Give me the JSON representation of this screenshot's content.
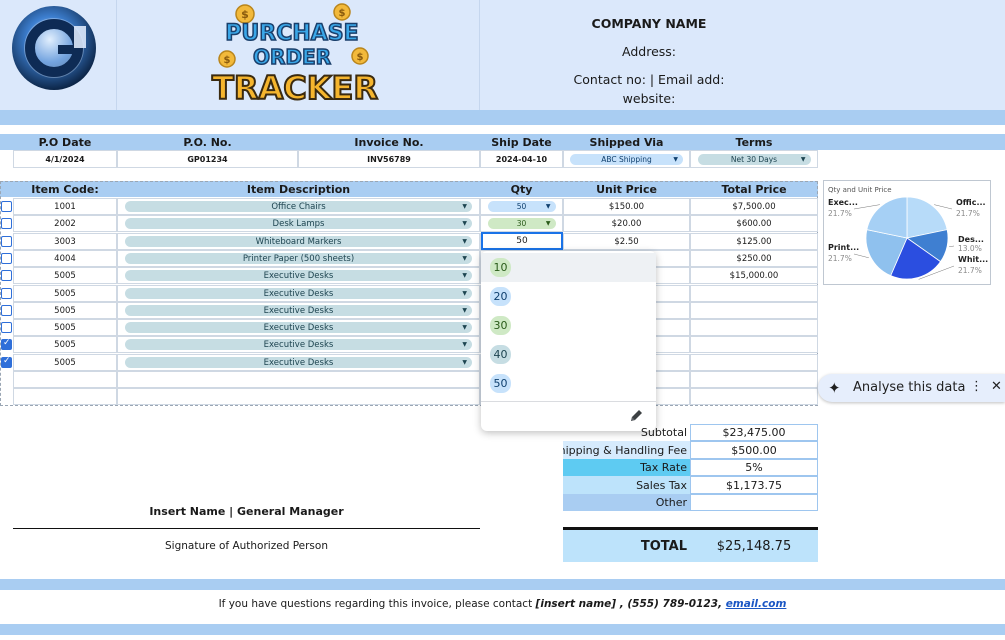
{
  "header": {
    "logo_letter": "G",
    "title_line1": "PURCHASE",
    "title_line2": "ORDER",
    "title_line3": "TRACKER",
    "company_name": "COMPANY NAME",
    "address": "Address:",
    "contact": "Contact no: | Email add:",
    "website": "website:"
  },
  "po": {
    "headers": [
      "P.O Date",
      "P.O. No.",
      "Invoice No.",
      "Ship Date",
      "Shipped Via",
      "Terms"
    ],
    "po_date": "4/1/2024",
    "po_no": "GP01234",
    "invoice_no": "INV56789",
    "ship_date": "2024-04-10",
    "shipped_via": "ABC Shipping",
    "terms": "Net 30 Days"
  },
  "items": {
    "headers": [
      "Item Code:",
      "Item Description",
      "Qty",
      "Unit Price",
      "Total Price"
    ],
    "rows": [
      {
        "code": "1001",
        "desc": "Office Chairs",
        "qty": "50",
        "unit": "$150.00",
        "total": "$7,500.00",
        "checked": false
      },
      {
        "code": "2002",
        "desc": "Desk Lamps",
        "qty": "30",
        "unit": "$20.00",
        "total": "$600.00",
        "checked": false
      },
      {
        "code": "3003",
        "desc": "Whiteboard Markers",
        "qty": "50",
        "unit": "$2.50",
        "total": "$125.00",
        "checked": false
      },
      {
        "code": "4004",
        "desc": "Printer Paper (500 sheets)",
        "qty": "",
        "unit": "",
        "total": "$250.00",
        "checked": false
      },
      {
        "code": "5005",
        "desc": "Executive Desks",
        "qty": "",
        "unit": "",
        "total": "$15,000.00",
        "checked": false
      },
      {
        "code": "5005",
        "desc": "Executive Desks",
        "qty": "",
        "unit": "",
        "total": "",
        "checked": false
      },
      {
        "code": "5005",
        "desc": "Executive Desks",
        "qty": "",
        "unit": "",
        "total": "",
        "checked": false
      },
      {
        "code": "5005",
        "desc": "Executive Desks",
        "qty": "",
        "unit": "",
        "total": "",
        "checked": false
      },
      {
        "code": "5005",
        "desc": "Executive Desks",
        "qty": "",
        "unit": "",
        "total": "",
        "checked": true
      },
      {
        "code": "5005",
        "desc": "Executive Desks",
        "qty": "",
        "unit": "",
        "total": "",
        "checked": true
      }
    ]
  },
  "qty_dropdown": {
    "options": [
      "10",
      "20",
      "30",
      "40",
      "50"
    ],
    "highlighted": "10",
    "edit_icon": "pencil-icon"
  },
  "chart_data": {
    "type": "pie",
    "title": "Qty and Unit Price",
    "categories": [
      "Office Chairs",
      "Desk Lamps",
      "Whiteboard Markers",
      "Printer Paper",
      "Executive Desks"
    ],
    "display_labels": [
      "Offic...",
      "Des...",
      "Whit...",
      "Print...",
      "Exec..."
    ],
    "values": [
      21.7,
      13.0,
      21.7,
      21.7,
      21.7
    ],
    "value_labels": [
      "21.7%",
      "13.0%",
      "21.7%",
      "21.7%",
      "21.7%"
    ],
    "colors": [
      "#b7dbf9",
      "#3f7fd1",
      "#2b4ee0",
      "#8fc1ee",
      "#a6d0f5"
    ]
  },
  "analyse": {
    "label": "Analyse this data",
    "sparkle_icon": "sparkle-icon",
    "more_icon": "more-vert-icon",
    "close_icon": "close-icon"
  },
  "totals": {
    "subtotal_label": "Subtotal",
    "subtotal": "$23,475.00",
    "shipping_label": "Shipping & Handling Fee",
    "shipping": "$500.00",
    "taxrate_label": "Tax Rate",
    "taxrate": "5%",
    "salestax_label": "Sales Tax",
    "salestax": "$1,173.75",
    "other_label": "Other",
    "other": "",
    "total_label": "TOTAL",
    "total": "$25,148.75"
  },
  "signature": {
    "name": "Insert Name | General Manager",
    "caption": "Signature of Authorized Person"
  },
  "footer": {
    "text": "If you have questions regarding this invoice, please contact ",
    "contact_name": "[insert name] , (555) 789-0123, ",
    "email": "email.com"
  },
  "colors": {
    "header_bg": "#dbe8fb",
    "band": "#a9cdf2",
    "accent": "#2f6fd9",
    "tax_row": "#5ecbf2",
    "total_bg": "#bde3fb"
  }
}
